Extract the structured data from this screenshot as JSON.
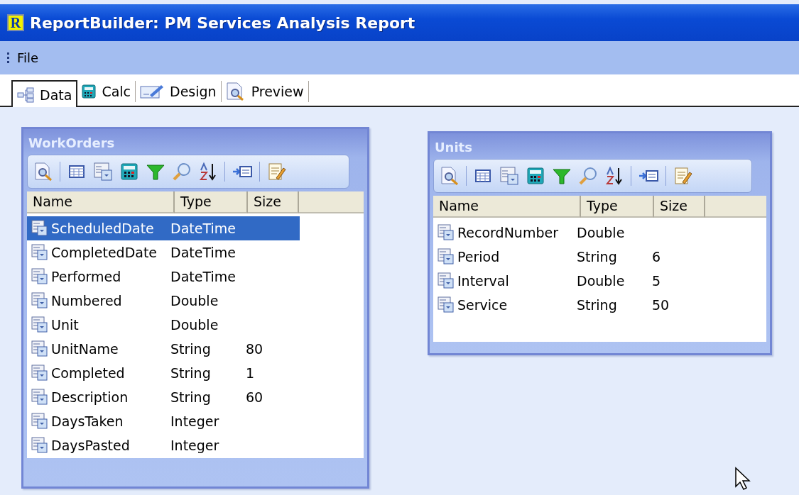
{
  "window": {
    "icon_letter": "R",
    "title": "ReportBuilder: PM Services Analysis Report"
  },
  "menu": [
    "File"
  ],
  "tabs": [
    {
      "label": "Data",
      "selected": true,
      "kind": "data"
    },
    {
      "label": "Calc",
      "selected": false,
      "kind": "calc"
    },
    {
      "label": "Design",
      "selected": false,
      "kind": "design"
    },
    {
      "label": "Preview",
      "selected": false,
      "kind": "preview"
    }
  ],
  "tables": [
    {
      "name": "WorkOrders",
      "columns": [
        "Name",
        "Type",
        "Size"
      ],
      "fields": [
        {
          "name": "ScheduledDate",
          "type": "DateTime",
          "selected": true
        },
        {
          "name": "CompletedDate",
          "type": "DateTime",
          "selected": false
        },
        {
          "name": "Performed",
          "type": "DateTime",
          "selected": false
        },
        {
          "name": "Numbered",
          "type": "Double",
          "selected": false
        },
        {
          "name": "Unit",
          "type": "Double",
          "selected": false
        },
        {
          "name": "UnitName",
          "type": "String",
          "size": "80",
          "selected": false
        },
        {
          "name": "Completed",
          "type": "String",
          "size": "1",
          "selected": false
        },
        {
          "name": "Description",
          "type": "String",
          "size": "60",
          "selected": false
        },
        {
          "name": "DaysTaken",
          "type": "Integer",
          "selected": false
        },
        {
          "name": "DaysPasted",
          "type": "Integer",
          "selected": false
        }
      ]
    },
    {
      "name": "Units",
      "columns": [
        "Name",
        "Type",
        "Size"
      ],
      "fields": [
        {
          "name": "RecordNumber",
          "type": "Double",
          "selected": false
        },
        {
          "name": "Period",
          "type": "String",
          "size": "6",
          "selected": false
        },
        {
          "name": "Interval",
          "type": "Double",
          "size": "5",
          "selected": false
        },
        {
          "name": "Service",
          "type": "String",
          "size": "50",
          "selected": false
        }
      ]
    }
  ]
}
